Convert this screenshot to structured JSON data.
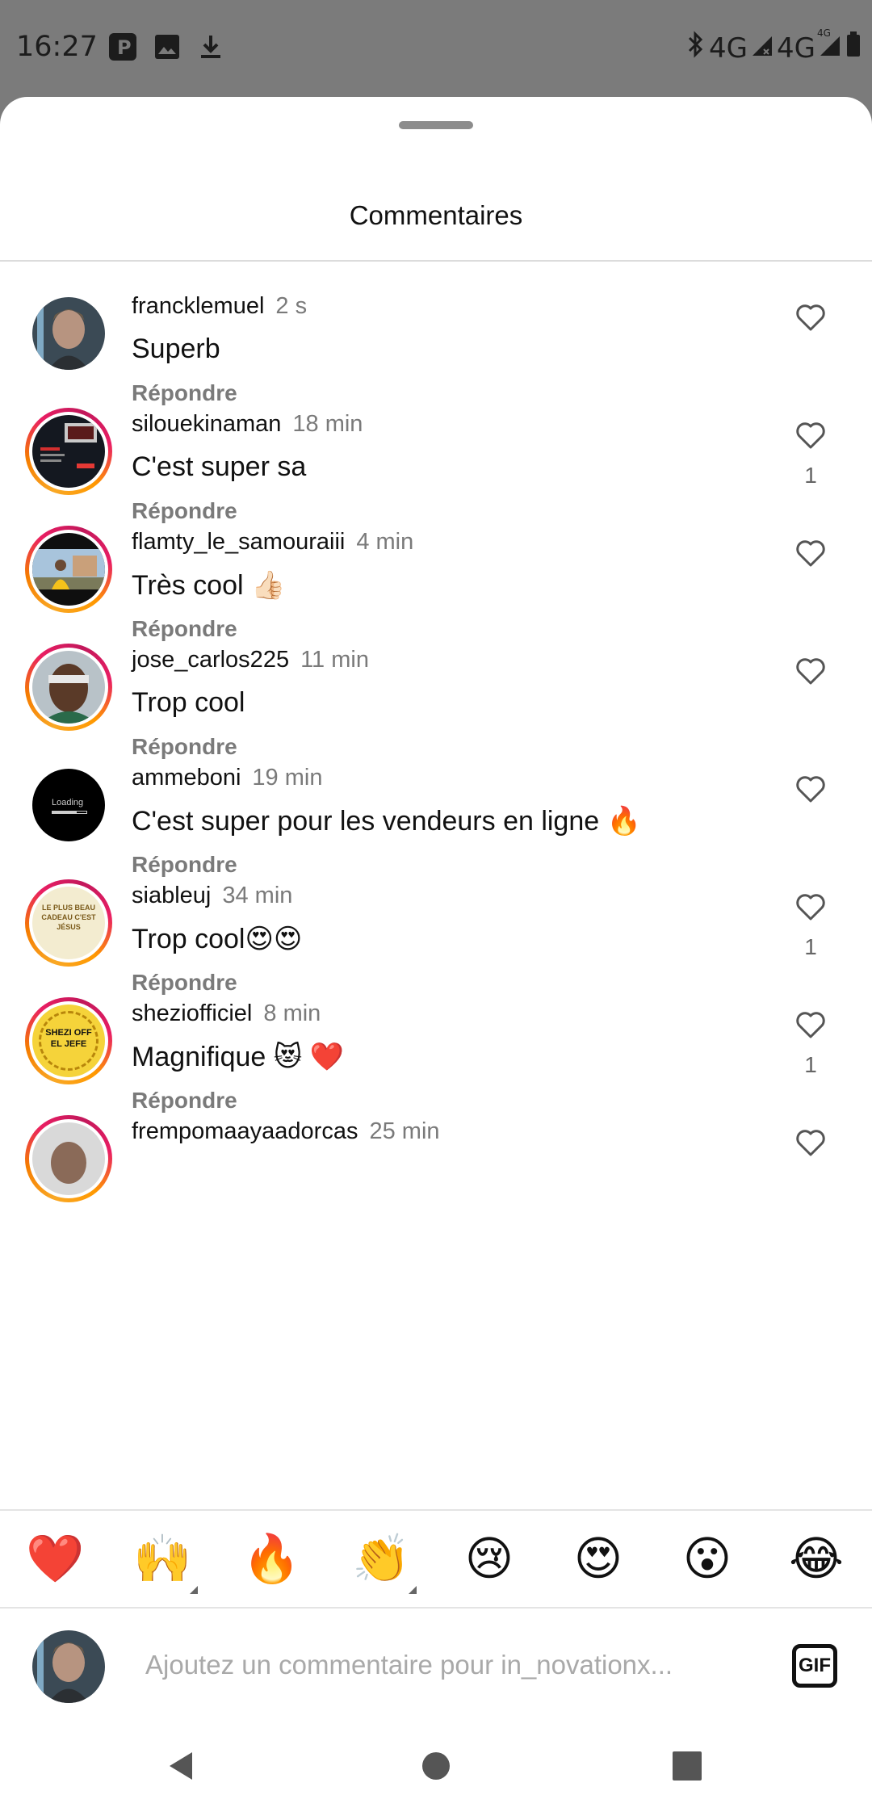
{
  "status_bar": {
    "time": "16:27",
    "left_icons": [
      "parking-icon",
      "image-icon",
      "download-icon"
    ],
    "network_1": "4G",
    "network_2": "4G",
    "network_2_badge": "4G"
  },
  "sheet": {
    "title": "Commentaires"
  },
  "comments": [
    {
      "username": "francklemuel",
      "time": "2 s",
      "text": "Superb",
      "reply": "Répondre",
      "likes": "",
      "ring": false
    },
    {
      "username": "silouekinaman",
      "time": "18 min",
      "text": "C'est super sa",
      "reply": "Répondre",
      "likes": "1",
      "ring": true
    },
    {
      "username": "flamty_le_samouraiii",
      "time": "4 min",
      "text": "Très cool 👍🏻",
      "reply": "Répondre",
      "likes": "",
      "ring": true
    },
    {
      "username": "jose_carlos225",
      "time": "11 min",
      "text": "Trop cool",
      "reply": "Répondre",
      "likes": "",
      "ring": true
    },
    {
      "username": "ammeboni",
      "time": "19 min",
      "text": "C'est super pour les vendeurs en ligne 🔥",
      "reply": "Répondre",
      "likes": "",
      "ring": false,
      "avatar_text": "Loading"
    },
    {
      "username": "siableuj",
      "time": "34 min",
      "text": "Trop cool😍😍",
      "reply": "Répondre",
      "likes": "1",
      "ring": true,
      "avatar_text": "LE PLUS BEAU CADEAU C'EST JÉSUS"
    },
    {
      "username": "sheziofficiel",
      "time": "8 min",
      "text": "Magnifique 😻 ❤️",
      "reply": "Répondre",
      "likes": "1",
      "ring": true,
      "avatar_text": "SHEZI OFF EL JEFE"
    },
    {
      "username": "frempomaayaadorcas",
      "time": "25 min",
      "text": "",
      "reply": "",
      "likes": "",
      "ring": true
    }
  ],
  "emoji_bar": [
    "❤️",
    "🙌",
    "🔥",
    "👏",
    "😢",
    "😍",
    "😮",
    "😂"
  ],
  "input": {
    "placeholder": "Ajoutez un commentaire pour in_novationx...",
    "gif_label": "GIF"
  },
  "colors": {
    "status_bg": "#7b7b7b",
    "ring_gradient": [
      "#f9a825",
      "#e91e63"
    ],
    "heart_red": "#e0245e"
  }
}
